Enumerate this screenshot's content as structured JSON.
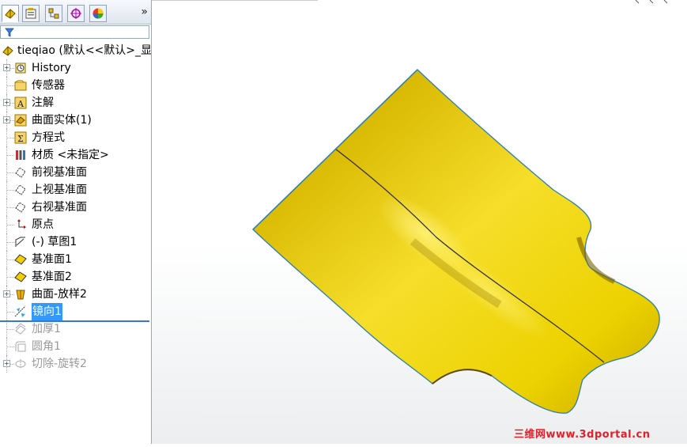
{
  "tabs": {
    "items": [
      {
        "name": "feature-manager-tab-icon",
        "active": true
      },
      {
        "name": "property-manager-tab-icon",
        "active": false
      },
      {
        "name": "configuration-manager-tab-icon",
        "active": false
      },
      {
        "name": "dimxpert-tab-icon",
        "active": false
      },
      {
        "name": "display-manager-tab-icon",
        "active": false
      }
    ],
    "more_label": "»"
  },
  "filter": {
    "placeholder": ""
  },
  "tree": {
    "root": {
      "label": "tieqiao (默认<<默认>_显"
    },
    "items": [
      {
        "label": "History",
        "icon": "history-icon",
        "expandable": true,
        "state": "normal"
      },
      {
        "label": "传感器",
        "icon": "sensor-icon",
        "expandable": false,
        "state": "normal"
      },
      {
        "label": "注解",
        "icon": "annotation-icon",
        "expandable": true,
        "state": "normal"
      },
      {
        "label": "曲面实体(1)",
        "icon": "surface-bodies-icon",
        "expandable": true,
        "state": "normal"
      },
      {
        "label": "方程式",
        "icon": "equations-icon",
        "expandable": false,
        "state": "normal"
      },
      {
        "label": "材质 <未指定>",
        "icon": "material-icon",
        "expandable": false,
        "state": "normal"
      },
      {
        "label": "前视基准面",
        "icon": "plane-icon",
        "expandable": false,
        "state": "normal"
      },
      {
        "label": "上视基准面",
        "icon": "plane-icon",
        "expandable": false,
        "state": "normal"
      },
      {
        "label": "右视基准面",
        "icon": "plane-icon",
        "expandable": false,
        "state": "normal"
      },
      {
        "label": "原点",
        "icon": "origin-icon",
        "expandable": false,
        "state": "normal"
      },
      {
        "label": "(-) 草图1",
        "icon": "sketch-icon",
        "expandable": false,
        "state": "normal"
      },
      {
        "label": "基准面1",
        "icon": "ref-plane-icon",
        "expandable": false,
        "state": "normal"
      },
      {
        "label": "基准面2",
        "icon": "ref-plane-icon",
        "expandable": false,
        "state": "normal"
      },
      {
        "label": "曲面-放样2",
        "icon": "surface-loft-icon",
        "expandable": true,
        "state": "normal"
      },
      {
        "label": "镜向1",
        "icon": "mirror-icon",
        "expandable": false,
        "state": "selected"
      },
      {
        "label": "加厚1",
        "icon": "thicken-icon",
        "expandable": false,
        "state": "suppressed"
      },
      {
        "label": "圆角1",
        "icon": "fillet-icon",
        "expandable": false,
        "state": "suppressed"
      },
      {
        "label": "切除-旋转2",
        "icon": "cut-revolve-icon",
        "expandable": true,
        "state": "suppressed"
      }
    ]
  },
  "colors": {
    "surface_yellow": "#f2d61a",
    "surface_dark": "#8a6f00",
    "edge_blue": "#2a7fb0",
    "selection": "#3399ff"
  },
  "watermark": "三维网www.3dportal.cn"
}
